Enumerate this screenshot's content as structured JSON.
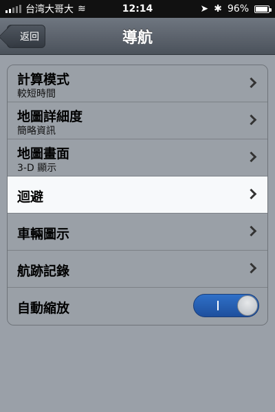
{
  "status_bar": {
    "carrier": "台湾大哥大",
    "time": "12:14",
    "battery_percent": "96%",
    "battery_level": 0.96
  },
  "nav": {
    "title": "導航",
    "back_label": "返回"
  },
  "settings": [
    {
      "title": "計算模式",
      "subtitle": "較短時間",
      "type": "disclosure"
    },
    {
      "title": "地圖詳細度",
      "subtitle": "簡略資訊",
      "type": "disclosure"
    },
    {
      "title": "地圖畫面",
      "subtitle": "3-D 顯示",
      "type": "disclosure"
    },
    {
      "title": "迴避",
      "subtitle": "",
      "type": "disclosure",
      "selected": true
    },
    {
      "title": "車輛圖示",
      "subtitle": "",
      "type": "disclosure"
    },
    {
      "title": "航跡記錄",
      "subtitle": "",
      "type": "disclosure"
    },
    {
      "title": "自動縮放",
      "subtitle": "",
      "type": "toggle",
      "value": "on"
    }
  ],
  "colors": {
    "toggle_on": "#2f70c8",
    "selected_row": "#f7f9fb",
    "row_bg": "#9aa0a7"
  }
}
